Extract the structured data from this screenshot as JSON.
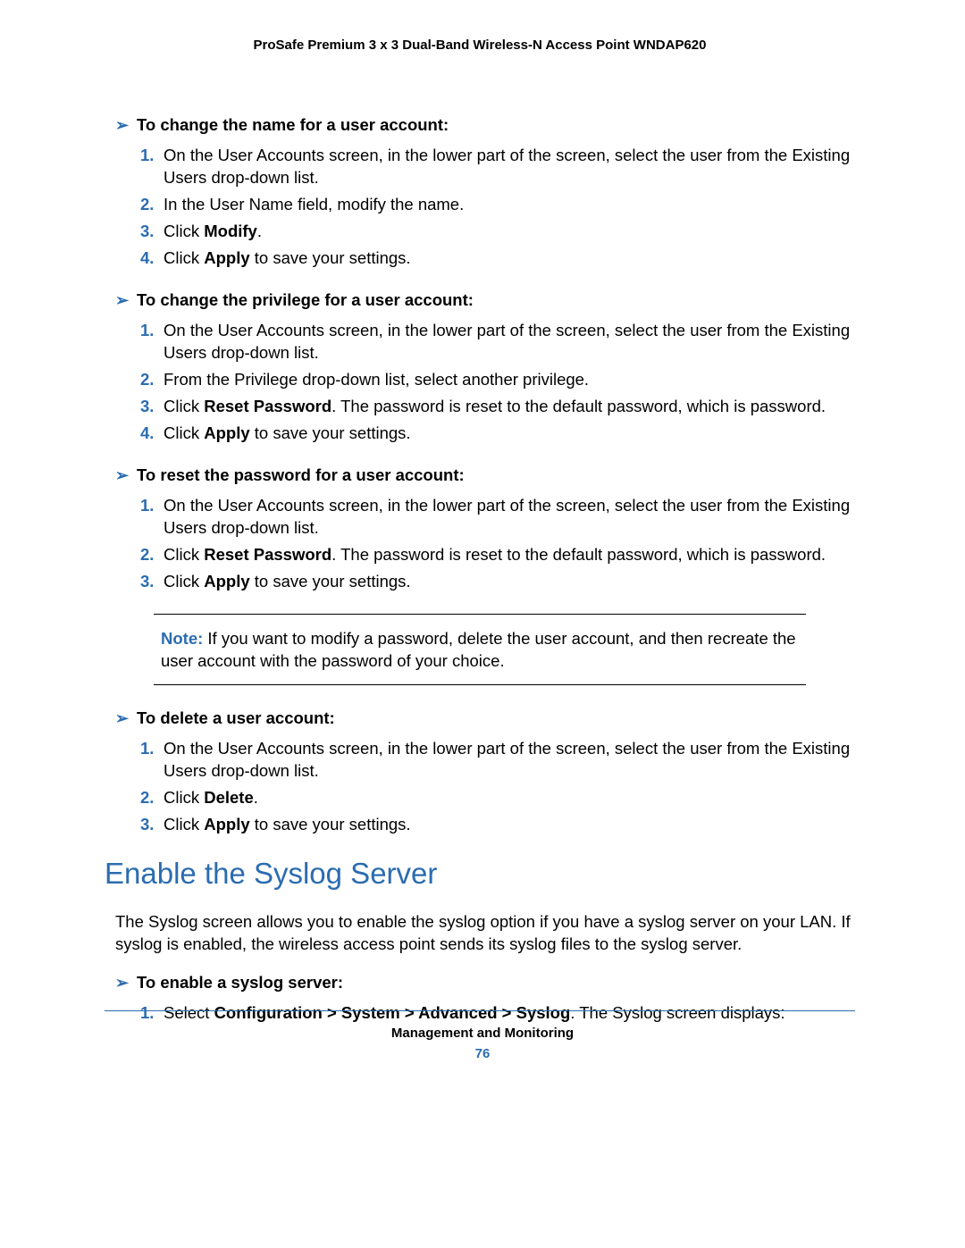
{
  "header": {
    "title": "ProSafe Premium 3 x 3 Dual-Band Wireless-N Access Point WNDAP620"
  },
  "tasks": [
    {
      "title": "To change the name for a user account:",
      "steps": [
        {
          "pre": "On the User Accounts screen, in the lower part of the screen, select the user from the Existing Users drop-down list."
        },
        {
          "pre": "In the User Name field, modify the name."
        },
        {
          "pre": "Click ",
          "bold": "Modify",
          "post": "."
        },
        {
          "pre": "Click ",
          "bold": "Apply",
          "post": " to save your settings."
        }
      ]
    },
    {
      "title": "To change the privilege for a user account:",
      "steps": [
        {
          "pre": "On the User Accounts screen, in the lower part of the screen, select the user from the Existing Users drop-down list."
        },
        {
          "pre": "From the Privilege drop-down list, select another privilege."
        },
        {
          "pre": "Click ",
          "bold": "Reset Password",
          "post": ". The password is reset to the default password, which is password."
        },
        {
          "pre": "Click ",
          "bold": "Apply",
          "post": " to save your settings."
        }
      ]
    },
    {
      "title": "To reset the password for a user account:",
      "steps": [
        {
          "pre": "On the User Accounts screen, in the lower part of the screen, select the user from the Existing Users drop-down list."
        },
        {
          "pre": "Click ",
          "bold": "Reset Password",
          "post": ". The password is reset to the default password, which is password."
        },
        {
          "pre": "Click ",
          "bold": "Apply",
          "post": " to save your settings."
        }
      ]
    },
    {
      "title": "To delete a user account:",
      "steps": [
        {
          "pre": "On the User Accounts screen, in the lower part of the screen, select the user from the Existing Users drop-down list."
        },
        {
          "pre": "Click ",
          "bold": "Delete",
          "post": "."
        },
        {
          "pre": "Click ",
          "bold": "Apply",
          "post": " to save your settings."
        }
      ]
    }
  ],
  "note": {
    "label": "Note:",
    "text": " If you want to modify a password, delete the user account, and then recreate the user account with the password of your choice."
  },
  "section": {
    "heading": "Enable the Syslog Server",
    "para": "The Syslog screen allows you to enable the syslog option if you have a syslog server on your LAN. If syslog is enabled, the wireless access point sends its syslog files to the syslog server."
  },
  "task5": {
    "title": "To enable a syslog server:",
    "steps": [
      {
        "pre": "Select ",
        "bold": "Configuration > System > Advanced > Syslog",
        "post": ". The Syslog screen displays:"
      }
    ]
  },
  "footer": {
    "chapter": "Management and Monitoring",
    "page": "76"
  }
}
